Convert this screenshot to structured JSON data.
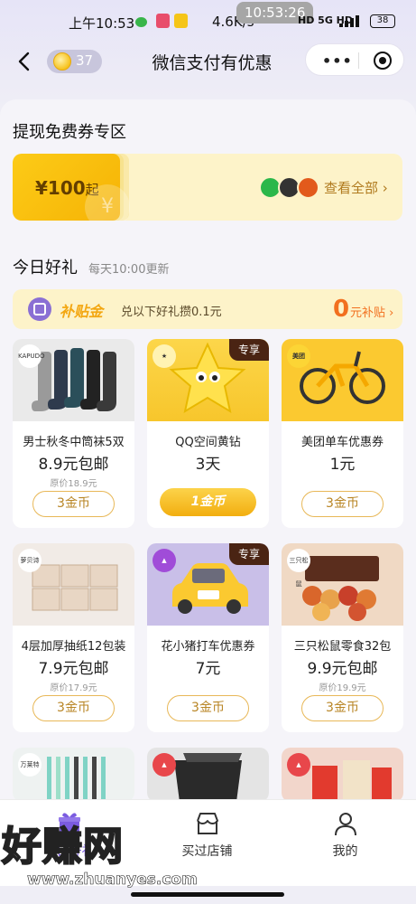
{
  "status": {
    "time": "上午10:53",
    "speed": "4.6K/s",
    "overlay_clock": "10:53:26",
    "signal": "HD 5G HD",
    "battery": "38"
  },
  "nav": {
    "coins": "37",
    "title": "微信支付有优惠"
  },
  "voucher_section": {
    "title": "提现免费券专区",
    "amount": "¥100",
    "amount_suffix": "起",
    "watermark": "¥",
    "see_all": "查看全部 ›"
  },
  "gift_section": {
    "title": "今日好礼",
    "subtitle": "每天10:00更新",
    "subsidy_logo": "补贴金",
    "subsidy_desc": "兑以下好礼攒0.1元",
    "subsidy_amount": "0",
    "subsidy_unit": "元补贴 ›"
  },
  "products": [
    {
      "name": "男士秋冬中筒袜5双",
      "price": "8.9元包邮",
      "orig": "原价18.9元",
      "btn": "3金币",
      "brand": "KAPUDO"
    },
    {
      "name": "QQ空间黄钻",
      "price": "3天",
      "orig": "",
      "btn": "1金币",
      "tag": "专享"
    },
    {
      "name": "美团单车优惠券",
      "price": "1元",
      "orig": "",
      "btn": "3金币",
      "brand": "美团"
    },
    {
      "name": "4层加厚抽纸12包装",
      "price": "7.9元包邮",
      "orig": "原价17.9元",
      "btn": "3金币",
      "brand": "萝贝诗"
    },
    {
      "name": "花小猪打车优惠券",
      "price": "7元",
      "orig": "",
      "btn": "3金币",
      "tag": "专享"
    },
    {
      "name": "三只松鼠零食32包",
      "price": "9.9元包邮",
      "orig": "原价19.9元",
      "btn": "3金币",
      "brand": "三只松鼠"
    },
    {
      "brand": "万莱特"
    },
    {},
    {}
  ],
  "tabs": [
    {
      "label": "今日好礼"
    },
    {
      "label": "买过店铺"
    },
    {
      "label": "我的"
    }
  ],
  "watermark": {
    "text": "好赚网",
    "url": "www.zhuanyes.com"
  },
  "colors": {
    "accent_gold": "#f6b305",
    "orange": "#f2701f",
    "purple": "#8a6fd4"
  }
}
